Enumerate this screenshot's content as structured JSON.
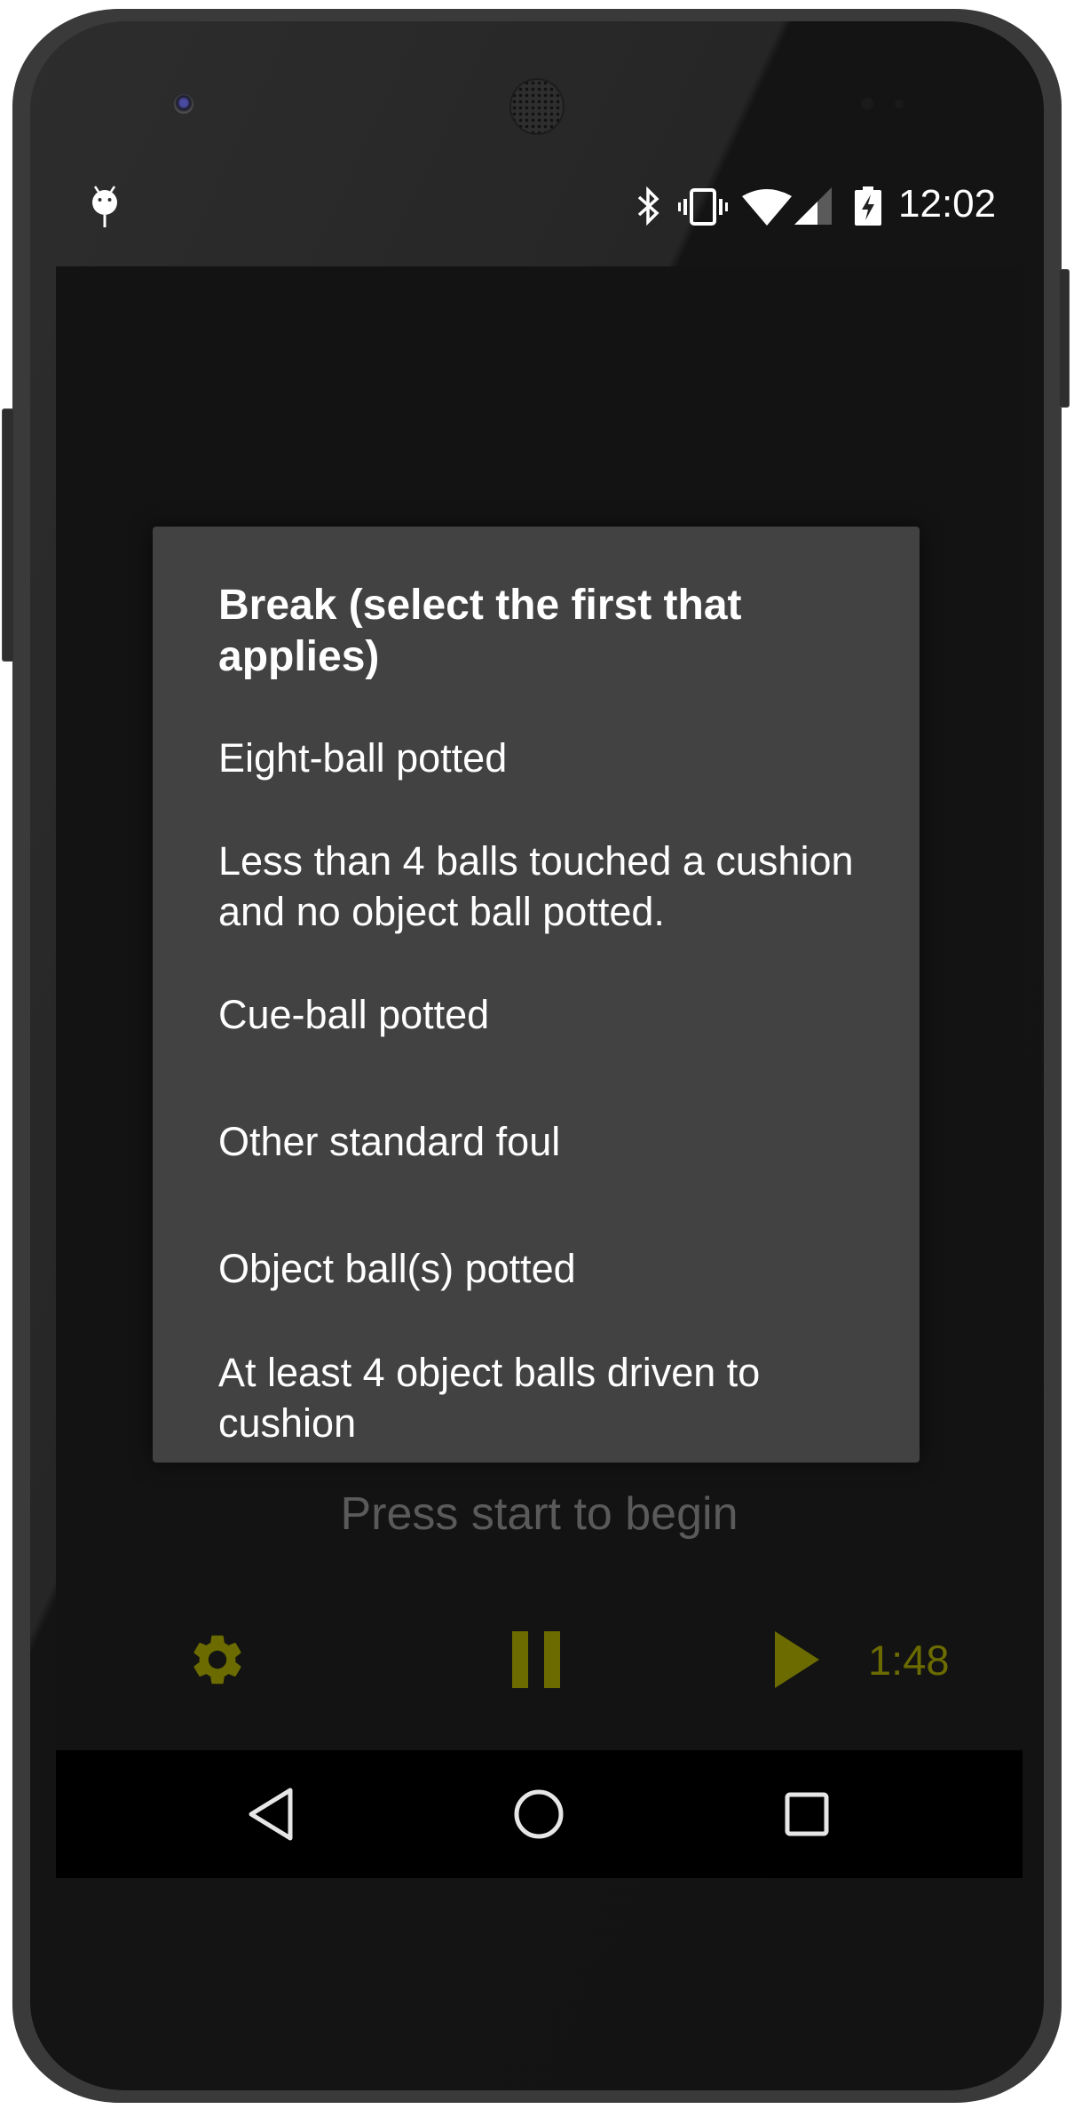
{
  "status_bar": {
    "time": "12:02",
    "left_icons": [
      "android-notification-icon"
    ],
    "right_icons": [
      "bluetooth-icon",
      "vibrate-icon",
      "wifi-icon",
      "cell-signal-icon",
      "battery-charging-icon"
    ]
  },
  "dialog": {
    "title": "Break (select the first that applies)",
    "items": [
      {
        "label": "Eight-ball potted"
      },
      {
        "label": "Less than 4 balls touched a cushion and no object ball potted."
      },
      {
        "label": "Cue-ball potted"
      },
      {
        "label": "Other standard foul"
      },
      {
        "label": "Object ball(s) potted"
      },
      {
        "label": "At least 4 object balls driven to cushion"
      }
    ]
  },
  "main": {
    "hint": "Press start to begin"
  },
  "controls": {
    "settings_icon": "gear-icon",
    "pause_icon": "pause-icon",
    "play_icon": "play-icon",
    "timer": "1:48",
    "accent_color": "#6b6b00"
  },
  "navigation_bar": {
    "buttons": [
      "back",
      "home",
      "recents"
    ]
  },
  "colors": {
    "dialog_bg": "#424242",
    "app_bg": "#131313",
    "hint_text": "#5a5a5a",
    "accent": "#6b6b00"
  }
}
